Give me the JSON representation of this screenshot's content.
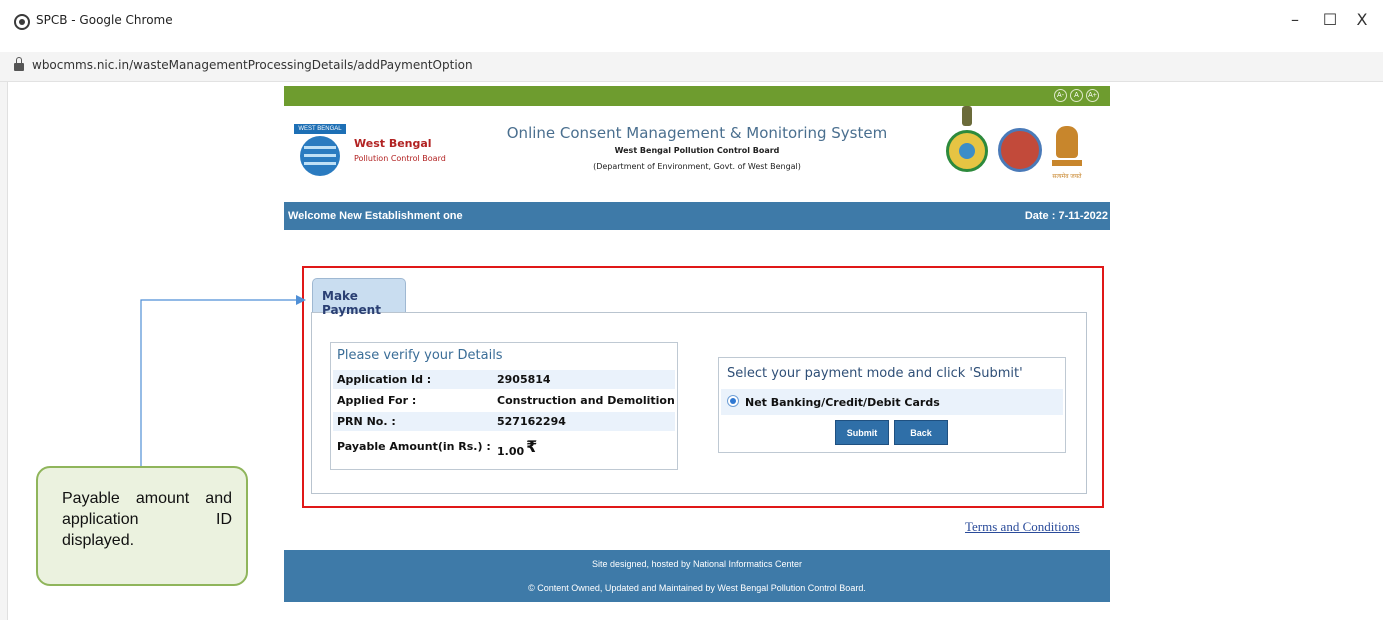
{
  "browser": {
    "window_title": "SPCB - Google Chrome",
    "url": "wbocmms.nic.in/wasteManagementProcessingDetails/addPaymentOption",
    "controls": {
      "minimize": "–",
      "maximize": "☐",
      "close": "X"
    }
  },
  "header": {
    "accessibility": [
      "A-",
      "A",
      "A+"
    ],
    "logo": {
      "tag": "WEST BENGAL",
      "name": "West Bengal",
      "sub": "Pollution Control Board"
    },
    "title": "Online Consent Management & Monitoring System",
    "subtitle1": "West Bengal Pollution Control Board",
    "subtitle2": "(Department of Environment, Govt. of West Bengal)",
    "emblem_text": "सत्यमेव जयते"
  },
  "welcome_bar": {
    "welcome": "Welcome New Establishment one",
    "date": "Date : 7-11-2022"
  },
  "payment": {
    "tab_label": "Make Payment",
    "details": {
      "title": "Please verify your Details",
      "rows": [
        {
          "label": "Application Id :",
          "value": "2905814"
        },
        {
          "label": "Applied For :",
          "value": "Construction and Demolition"
        },
        {
          "label": "PRN No. :",
          "value": "527162294"
        },
        {
          "label": "Payable Amount(in Rs.) :",
          "value": "1.00"
        }
      ],
      "currency_symbol": "₹"
    },
    "mode": {
      "title": "Select your payment mode and click 'Submit'",
      "option": "Net Banking/Credit/Debit Cards",
      "submit_label": "Submit",
      "back_label": "Back"
    }
  },
  "terms_link": "Terms and Conditions",
  "footer": {
    "line1": "Site designed, hosted by National Informatics Center",
    "line2": "© Content Owned, Updated and Maintained by West Bengal Pollution Control Board."
  },
  "callout": {
    "text": "Payable amount and application ID displayed."
  },
  "colors": {
    "header_green": "#6e9c2f",
    "bar_blue": "#3e7aa8",
    "highlight_red": "#e01818",
    "callout_border": "#8fb55b"
  }
}
